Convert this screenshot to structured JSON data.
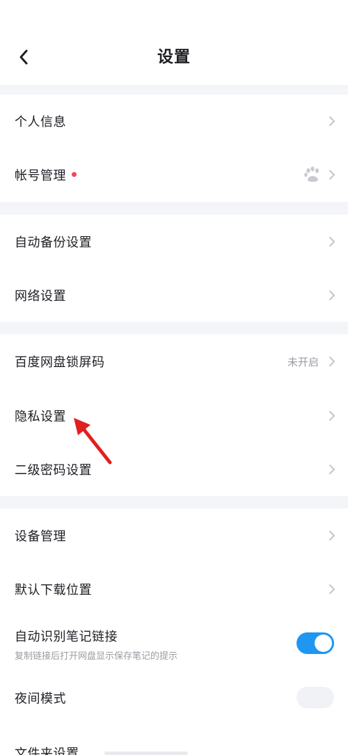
{
  "header": {
    "title": "设置",
    "back_icon": "chevron-left-icon"
  },
  "colors": {
    "accent": "#1e96f2",
    "badge": "#f0455a",
    "annotation": "#e02020",
    "divider_bg": "#f4f5f8"
  },
  "groups": [
    {
      "items": [
        {
          "label": "个人信息"
        },
        {
          "label": "帐号管理",
          "badge": true,
          "icon": "baidu-paw-icon"
        }
      ]
    },
    {
      "items": [
        {
          "label": "自动备份设置"
        },
        {
          "label": "网络设置"
        }
      ]
    },
    {
      "items": [
        {
          "label": "百度网盘锁屏码",
          "value": "未开启"
        },
        {
          "label": "隐私设置",
          "annotated": true
        },
        {
          "label": "二级密码设置"
        }
      ]
    },
    {
      "items": [
        {
          "label": "设备管理"
        },
        {
          "label": "默认下载位置"
        },
        {
          "label": "自动识别笔记链接",
          "sub": "复制链接后打开网盘显示保存笔记的提示",
          "toggle": true
        },
        {
          "label": "夜间模式"
        },
        {
          "label": "文件夹设置"
        }
      ]
    }
  ]
}
